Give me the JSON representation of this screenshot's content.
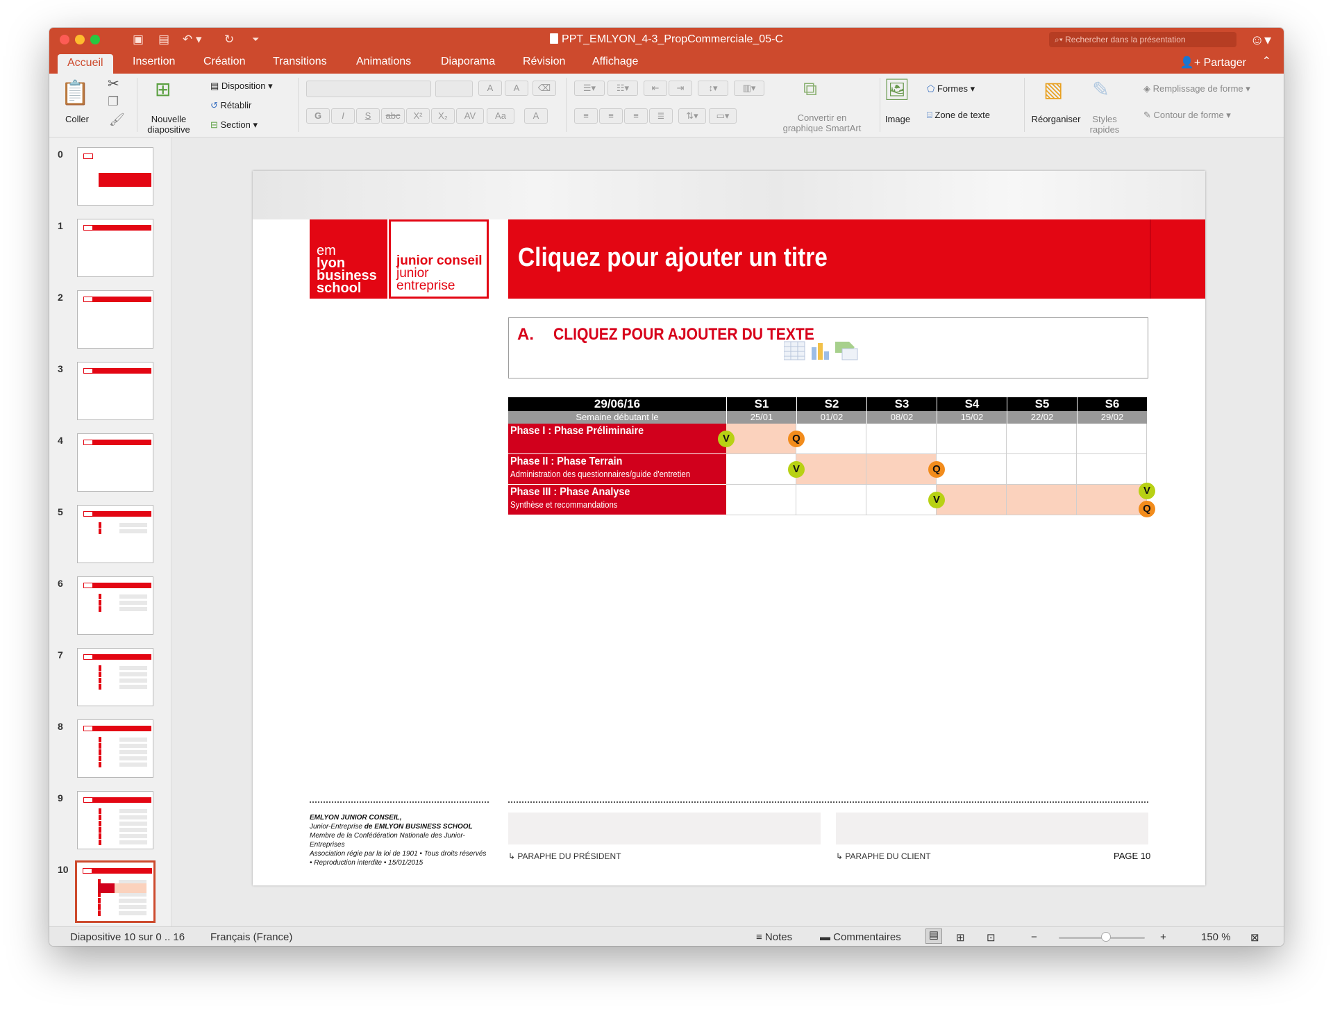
{
  "window": {
    "doc_title": "PPT_EMLYON_4-3_PropCommerciale_05-C",
    "search_placeholder": "Rechercher dans la présentation"
  },
  "tabs": [
    "Accueil",
    "Insertion",
    "Création",
    "Transitions",
    "Animations",
    "Diaporama",
    "Révision",
    "Affichage"
  ],
  "active_tab": "Accueil",
  "share_label": "Partager",
  "ribbon": {
    "paste": "Coller",
    "new_slide_1": "Nouvelle",
    "new_slide_2": "diapositive",
    "layout": "Disposition",
    "reset": "Rétablir",
    "section": "Section",
    "smartart_1": "Convertir en",
    "smartart_2": "graphique SmartArt",
    "image": "Image",
    "shapes": "Formes",
    "textbox": "Zone de texte",
    "arrange": "Réorganiser",
    "quick_styles_1": "Styles",
    "quick_styles_2": "rapides",
    "shape_fill": "Remplissage de forme",
    "shape_outline": "Contour de forme",
    "bold": "G",
    "italic": "I",
    "underline": "S",
    "strike": "abc",
    "superscript": "X²",
    "subscript": "X₂",
    "spacing": "AV",
    "case": "Aa",
    "grow": "A",
    "shrink": "A"
  },
  "thumbnails": [
    "0",
    "1",
    "2",
    "3",
    "4",
    "5",
    "6",
    "7",
    "8",
    "9",
    "10"
  ],
  "selected_slide": 10,
  "slide": {
    "logo_em": "em",
    "logo_lyon": "lyon",
    "logo_business": "business",
    "logo_school": "school",
    "logo_jc": "junior conseil",
    "logo_junior": "junior",
    "logo_entreprise": "entreprise",
    "title": "Cliquez pour ajouter un titre",
    "sub_letter": "A.",
    "sub_text": "CLIQUEZ POUR AJOUTER DU TEXTE",
    "gantt": {
      "date": "29/06/16",
      "week_label": "Semaine débutant le",
      "weeks": [
        "S1",
        "S2",
        "S3",
        "S4",
        "S5",
        "S6"
      ],
      "week_dates": [
        "25/01",
        "01/02",
        "08/02",
        "15/02",
        "22/02",
        "29/02"
      ],
      "phases": [
        {
          "title": "Phase I : Phase Préliminaire",
          "desc": ""
        },
        {
          "title": "Phase II : Phase Terrain",
          "desc": "Administration des questionnaires/guide d'entretien"
        },
        {
          "title": "Phase III : Phase Analyse",
          "desc": "Synthèse et recommandations"
        }
      ],
      "marker_v": "V",
      "marker_q": "Q"
    },
    "footer": {
      "org_1": "EMLYON JUNIOR CONSEIL,",
      "org_2a": "Junior-Entreprise ",
      "org_2b": "de EMLYON BUSINESS SCHOOL",
      "org_3": "Membre de la Confédération Nationale des Junior-Entreprises",
      "org_4": "Association régie par la loi de 1901 • Tous droits réservés • Reproduction interdite • 15/01/2015",
      "president": "PARAPHE DU PRÉSIDENT",
      "client": "PARAPHE DU CLIENT",
      "page": "PAGE 10"
    }
  },
  "status": {
    "slide_info": "Diapositive 10 sur 0 .. 16",
    "language": "Français (France)",
    "notes": "Notes",
    "comments": "Commentaires",
    "zoom": "150 %",
    "zoom_fraction": 0.55
  }
}
